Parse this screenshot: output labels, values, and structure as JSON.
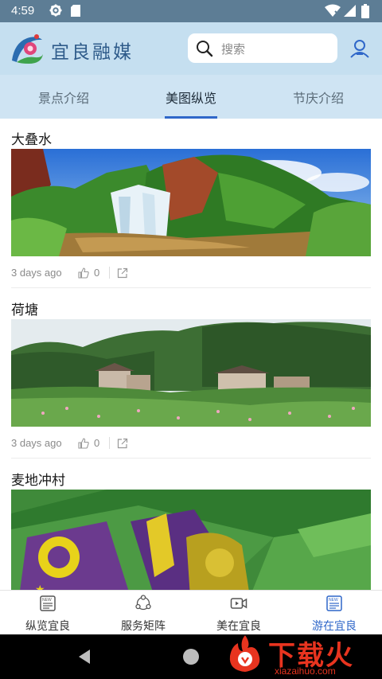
{
  "status_bar": {
    "time": "4:59"
  },
  "header": {
    "app_name": "宜良融媒",
    "search": {
      "placeholder": "搜索"
    }
  },
  "tabs": [
    {
      "label": "景点介绍",
      "active": false
    },
    {
      "label": "美图纵览",
      "active": true
    },
    {
      "label": "节庆介绍",
      "active": false
    }
  ],
  "feed": [
    {
      "title": "大叠水",
      "time": "3 days ago",
      "likes": "0"
    },
    {
      "title": "荷塘",
      "time": "3 days ago",
      "likes": "0"
    },
    {
      "title": "麦地冲村",
      "time": "",
      "likes": ""
    }
  ],
  "bottom_nav": [
    {
      "label": "纵览宜良",
      "icon": "news-icon",
      "active": false
    },
    {
      "label": "服务矩阵",
      "icon": "services-icon",
      "active": false
    },
    {
      "label": "美在宜良",
      "icon": "video-icon",
      "active": false
    },
    {
      "label": "游在宜良",
      "icon": "news-icon",
      "active": true
    }
  ],
  "watermark": {
    "text": "下载火",
    "url": "xiazaihuo.com"
  },
  "colors": {
    "accent": "#2f67c9",
    "header_bg": "#c5dff0",
    "watermark": "#e8341f"
  }
}
